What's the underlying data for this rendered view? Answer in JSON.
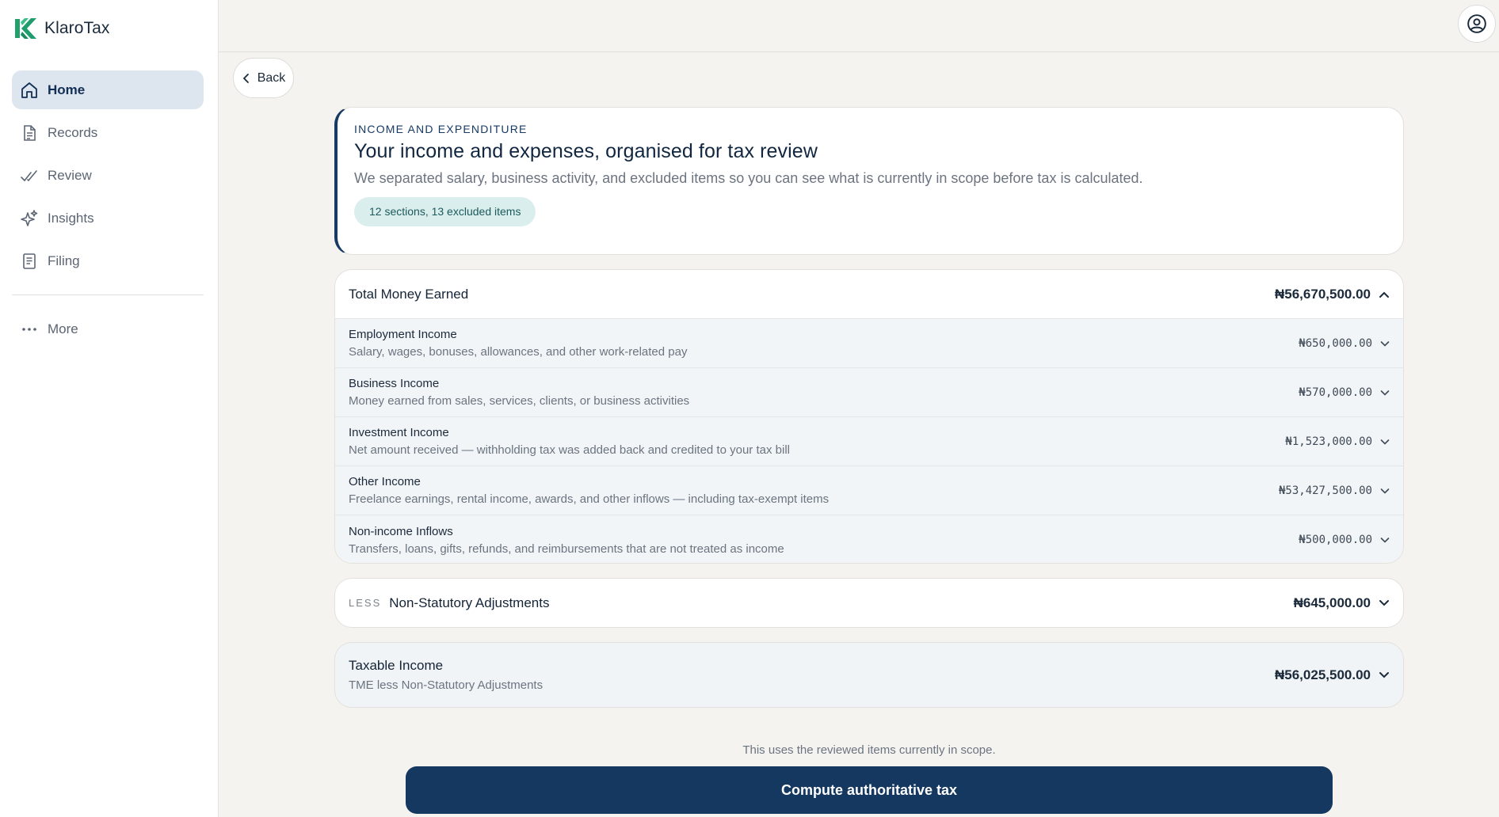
{
  "app": {
    "name": "KlaroTax"
  },
  "sidebar": {
    "items": [
      {
        "label": "Home",
        "icon": "home-icon",
        "active": true
      },
      {
        "label": "Records",
        "icon": "document-icon"
      },
      {
        "label": "Review",
        "icon": "double-check-icon"
      },
      {
        "label": "Insights",
        "icon": "sparkle-icon"
      },
      {
        "label": "Filing",
        "icon": "file-icon"
      }
    ],
    "more_label": "More"
  },
  "topbar": {
    "user_icon": "user-circle-icon"
  },
  "back": {
    "label": "Back"
  },
  "header": {
    "eyebrow": "INCOME AND EXPENDITURE",
    "title": "Your income and expenses, organised for tax review",
    "description": "We separated salary, business activity, and excluded items so you can see what is currently in scope before tax is calculated.",
    "badge": "12 sections, 13 excluded items"
  },
  "earned": {
    "title": "Total Money Earned",
    "amount": "₦56,670,500.00",
    "rows": [
      {
        "title": "Employment Income",
        "subtitle": "Salary, wages, bonuses, allowances, and other work-related pay",
        "amount": "₦650,000.00"
      },
      {
        "title": "Business Income",
        "subtitle": "Money earned from sales, services, clients, or business activities",
        "amount": "₦570,000.00"
      },
      {
        "title": "Investment Income",
        "subtitle": "Net amount received — withholding tax was added back and credited to your tax bill",
        "amount": "₦1,523,000.00"
      },
      {
        "title": "Other Income",
        "subtitle": "Freelance earnings, rental income, awards, and other inflows — including tax-exempt items",
        "amount": "₦53,427,500.00"
      },
      {
        "title": "Non-income Inflows",
        "subtitle": "Transfers, loans, gifts, refunds, and reimbursements that are not treated as income",
        "amount": "₦500,000.00"
      }
    ]
  },
  "adjustments": {
    "tag": "LESS",
    "title": "Non-Statutory Adjustments",
    "amount": "₦645,000.00"
  },
  "taxable": {
    "title": "Taxable Income",
    "subtitle": "TME less Non-Statutory Adjustments",
    "amount": "₦56,025,500.00"
  },
  "footer": {
    "note": "This uses the reviewed items currently in scope.",
    "compute_label": "Compute authoritative tax"
  },
  "colors": {
    "primary": "#143860",
    "accent_green": "#1f9d6e",
    "badge_bg": "#dbeeee"
  }
}
